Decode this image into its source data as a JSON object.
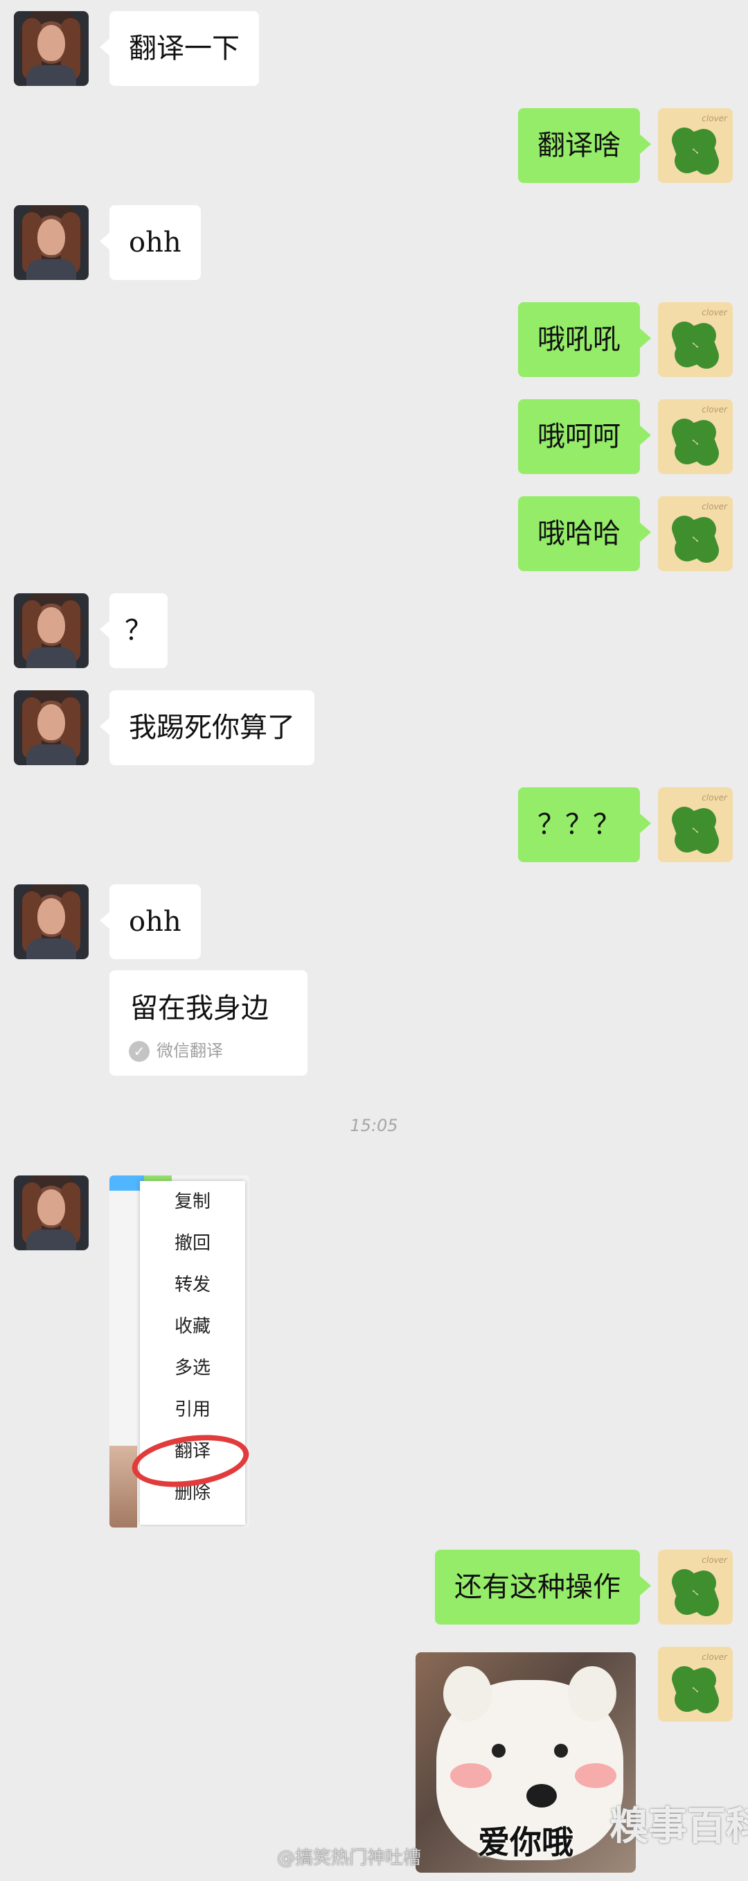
{
  "messages": {
    "m1": "翻译一下",
    "m2": "翻译啥",
    "m3": "ohh",
    "m4": "哦吼吼",
    "m5": "哦呵呵",
    "m6": "哦哈哈",
    "m7": "？",
    "m8": "我踢死你算了",
    "m9": "？？？",
    "m10": "ohh",
    "m11_translation": "留在我身边",
    "m11_label": "微信翻译",
    "m12": "还有这种操作"
  },
  "timestamp": "15:05",
  "context_menu": {
    "items": [
      "复制",
      "撤回",
      "转发",
      "收藏",
      "多选",
      "引用",
      "翻译",
      "删除"
    ]
  },
  "sticker": {
    "caption": "爱你哦"
  },
  "avatar": {
    "right_tag": "clover"
  },
  "watermark": {
    "weibo": "@搞笑热门神吐槽",
    "site": "糗事百科"
  },
  "colors": {
    "background": "#ececec",
    "outgoing": "#95ec69",
    "incoming": "#ffffff",
    "highlight": "#e23b3b"
  }
}
